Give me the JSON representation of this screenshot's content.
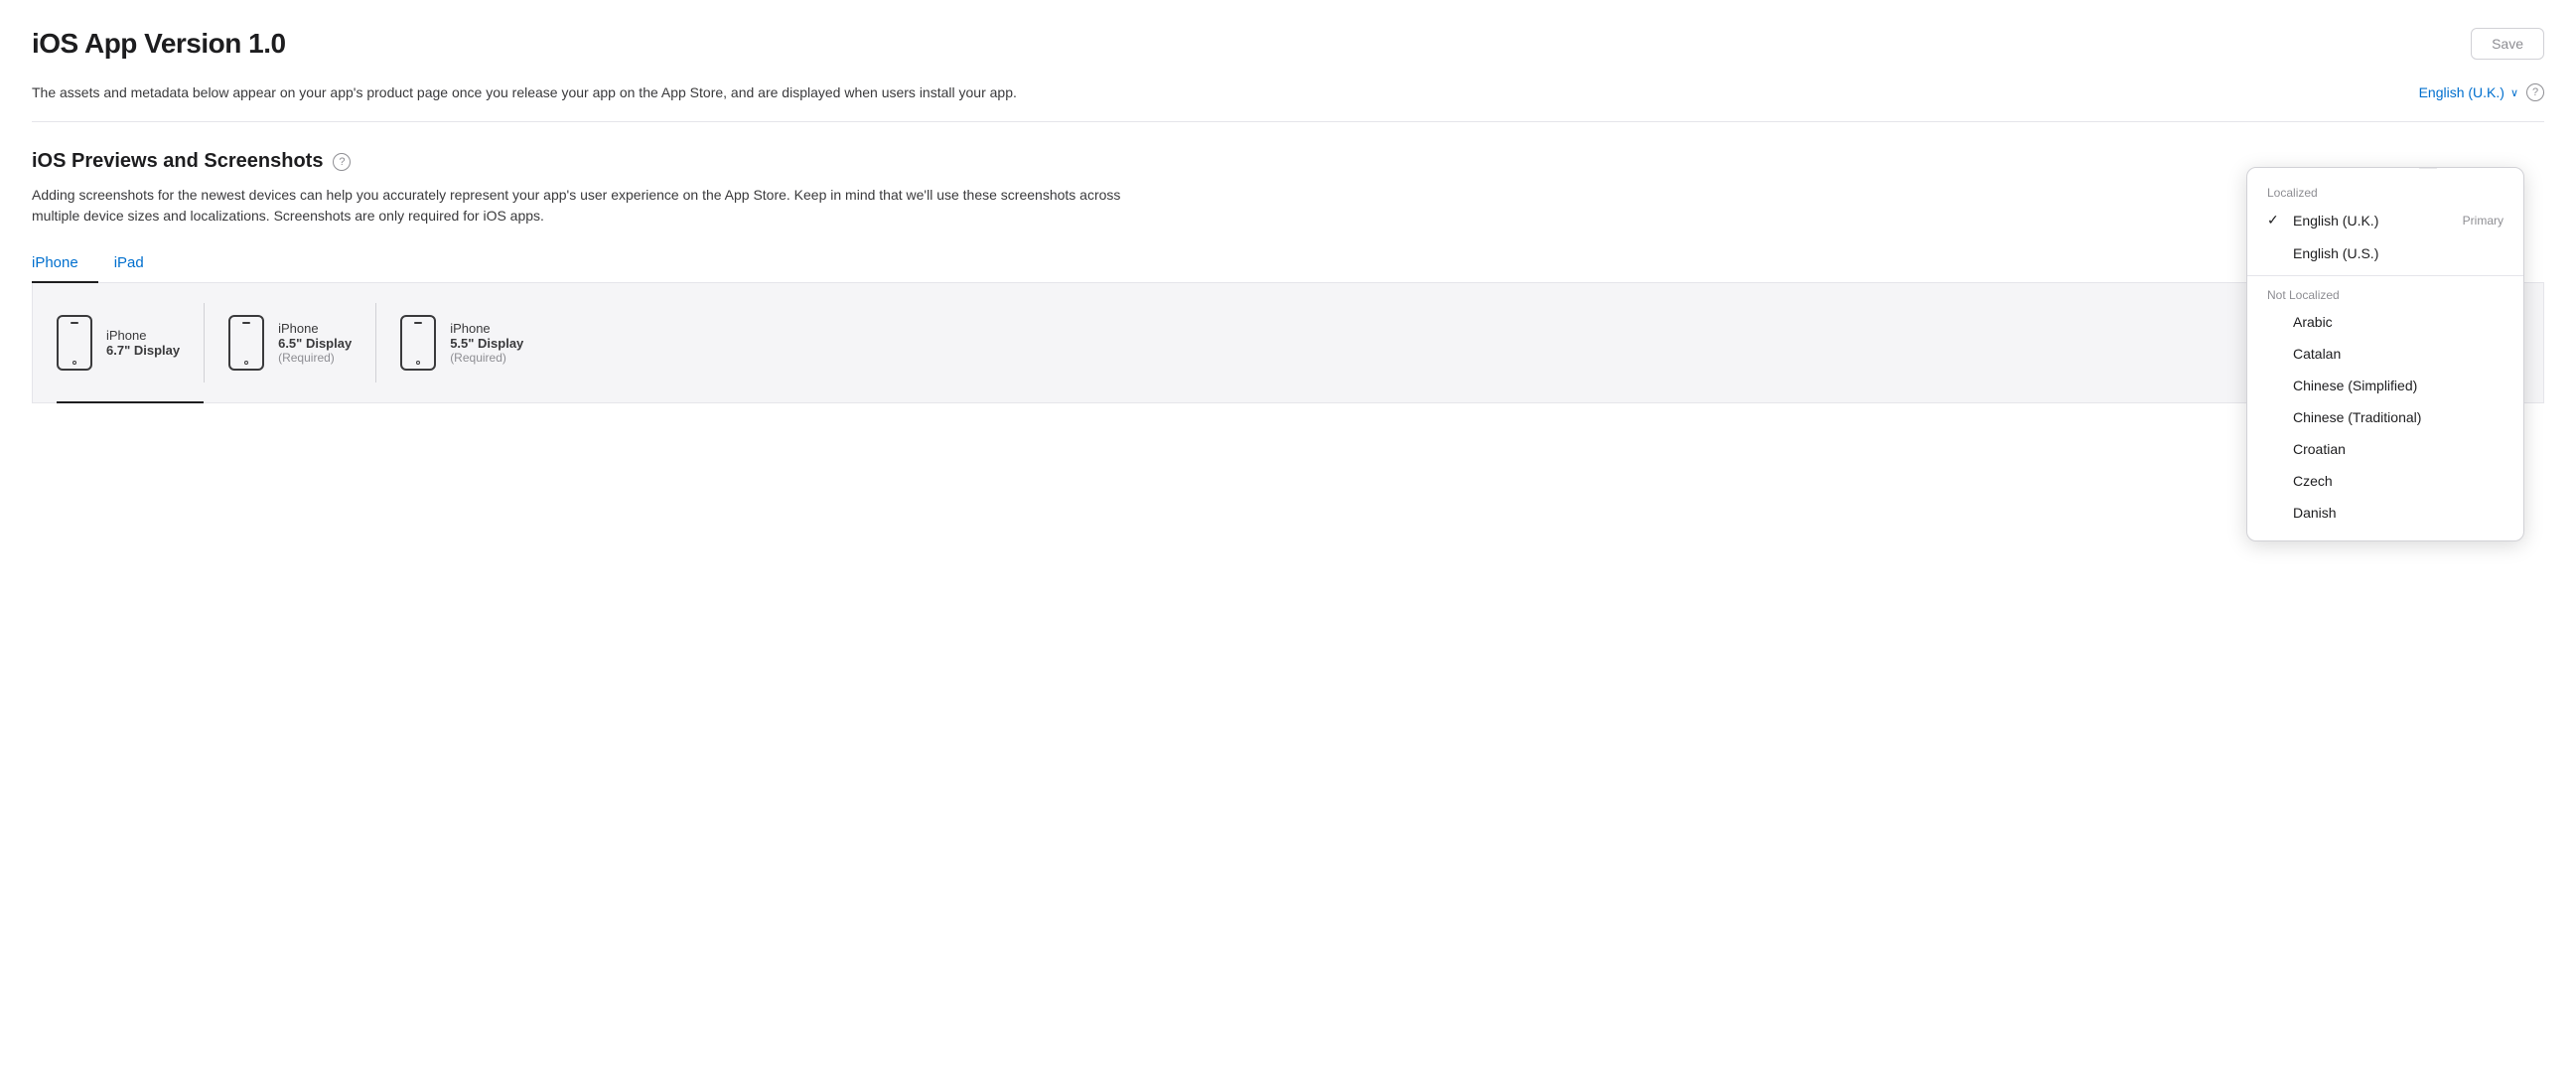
{
  "page": {
    "title": "iOS App Version 1.0",
    "save_button": "Save",
    "description": "The assets and metadata below appear on your app's product page once you release your app on the App Store, and are displayed when users install your app.",
    "language_selector": "English (U.K.)",
    "section": {
      "title": "iOS Previews and Screenshots",
      "description": "Adding screenshots for the newest devices can help you accurately represent your app's user experience on the App Store. Keep in mind that we'll use these screenshots across multiple device sizes and localizations. Screenshots are only required for iOS apps."
    },
    "tabs": [
      {
        "label": "iPhone",
        "active": true
      },
      {
        "label": "iPad",
        "active": false
      }
    ],
    "devices": [
      {
        "name": "iPhone",
        "size": "6.7\" Display",
        "required": null,
        "active": true
      },
      {
        "name": "iPhone",
        "size": "6.5\" Display",
        "required": "(Required)",
        "active": false
      },
      {
        "name": "iPhone",
        "size": "5.5\" Display",
        "required": "(Required)",
        "active": false
      }
    ],
    "dropdown": {
      "localized_section_label": "Localized",
      "localized_items": [
        {
          "label": "English (U.K.)",
          "badge": "Primary",
          "selected": true
        },
        {
          "label": "English (U.S.)",
          "badge": null,
          "selected": false
        }
      ],
      "not_localized_section_label": "Not Localized",
      "not_localized_items": [
        "Arabic",
        "Catalan",
        "Chinese (Simplified)",
        "Chinese (Traditional)",
        "Croatian",
        "Czech",
        "Danish"
      ]
    }
  }
}
